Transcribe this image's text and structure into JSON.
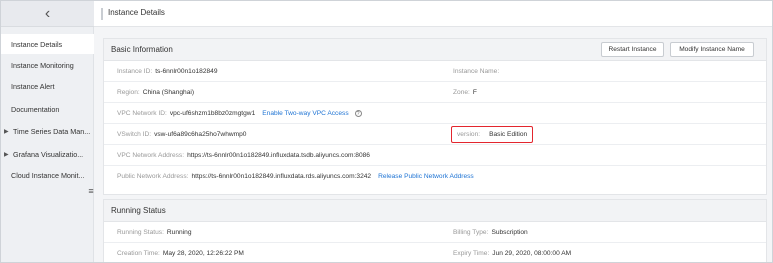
{
  "sidebar": {
    "back_icon": "chevron-left-icon",
    "items": [
      {
        "label": "Instance Details",
        "active": true,
        "expandable": false
      },
      {
        "label": "Instance Monitoring",
        "active": false,
        "expandable": false
      },
      {
        "label": "Instance Alert",
        "active": false,
        "expandable": false
      },
      {
        "label": "Documentation",
        "active": false,
        "expandable": false
      },
      {
        "label": "Time Series Data Man...",
        "active": false,
        "expandable": true
      },
      {
        "label": "Grafana Visualizatio...",
        "active": false,
        "expandable": true
      },
      {
        "label": "Cloud Instance Monit...",
        "active": false,
        "expandable": false
      }
    ]
  },
  "header": {
    "title": "Instance Details"
  },
  "basic": {
    "title": "Basic Information",
    "restart_label": "Restart Instance",
    "modify_label": "Modify Instance Name",
    "instance_id_label": "Instance ID:",
    "instance_id": "ts-6nnlr00n1o182849",
    "instance_name_label": "Instance Name:",
    "instance_name": "",
    "region_label": "Region:",
    "region": "China (Shanghai)",
    "zone_label": "Zone:",
    "zone": "F",
    "vpc_label": "VPC Network ID:",
    "vpc": "vpc-uf6shzm1b8bz0zmgtgw1",
    "vpc_link": "Enable Two-way VPC Access",
    "vswitch_label": "VSwitch ID:",
    "vswitch": "vsw-uf6a89c6ha25ho7whwmp0",
    "version_label": "version:",
    "version": "Basic Edition",
    "vpc_addr_label": "VPC Network Address:",
    "vpc_addr": "https://ts-6nnlr00n1o182849.influxdata.tsdb.aliyuncs.com:8086",
    "public_addr_label": "Public Network Address:",
    "public_addr": "https://ts-6nnlr00n1o182849.influxdata.rds.aliyuncs.com:3242",
    "public_link": "Release Public Network Address"
  },
  "running": {
    "title": "Running Status",
    "status_label": "Running Status:",
    "status": "Running",
    "billing_label": "Billing Type:",
    "billing": "Subscription",
    "created_label": "Creation Time:",
    "created": "May 28, 2020, 12:26:22 PM",
    "expiry_label": "Expiry Time:",
    "expiry": "Jun 29, 2020, 08:00:00 AM"
  },
  "colors": {
    "link": "#1f74d4",
    "highlight": "#e3262e"
  }
}
